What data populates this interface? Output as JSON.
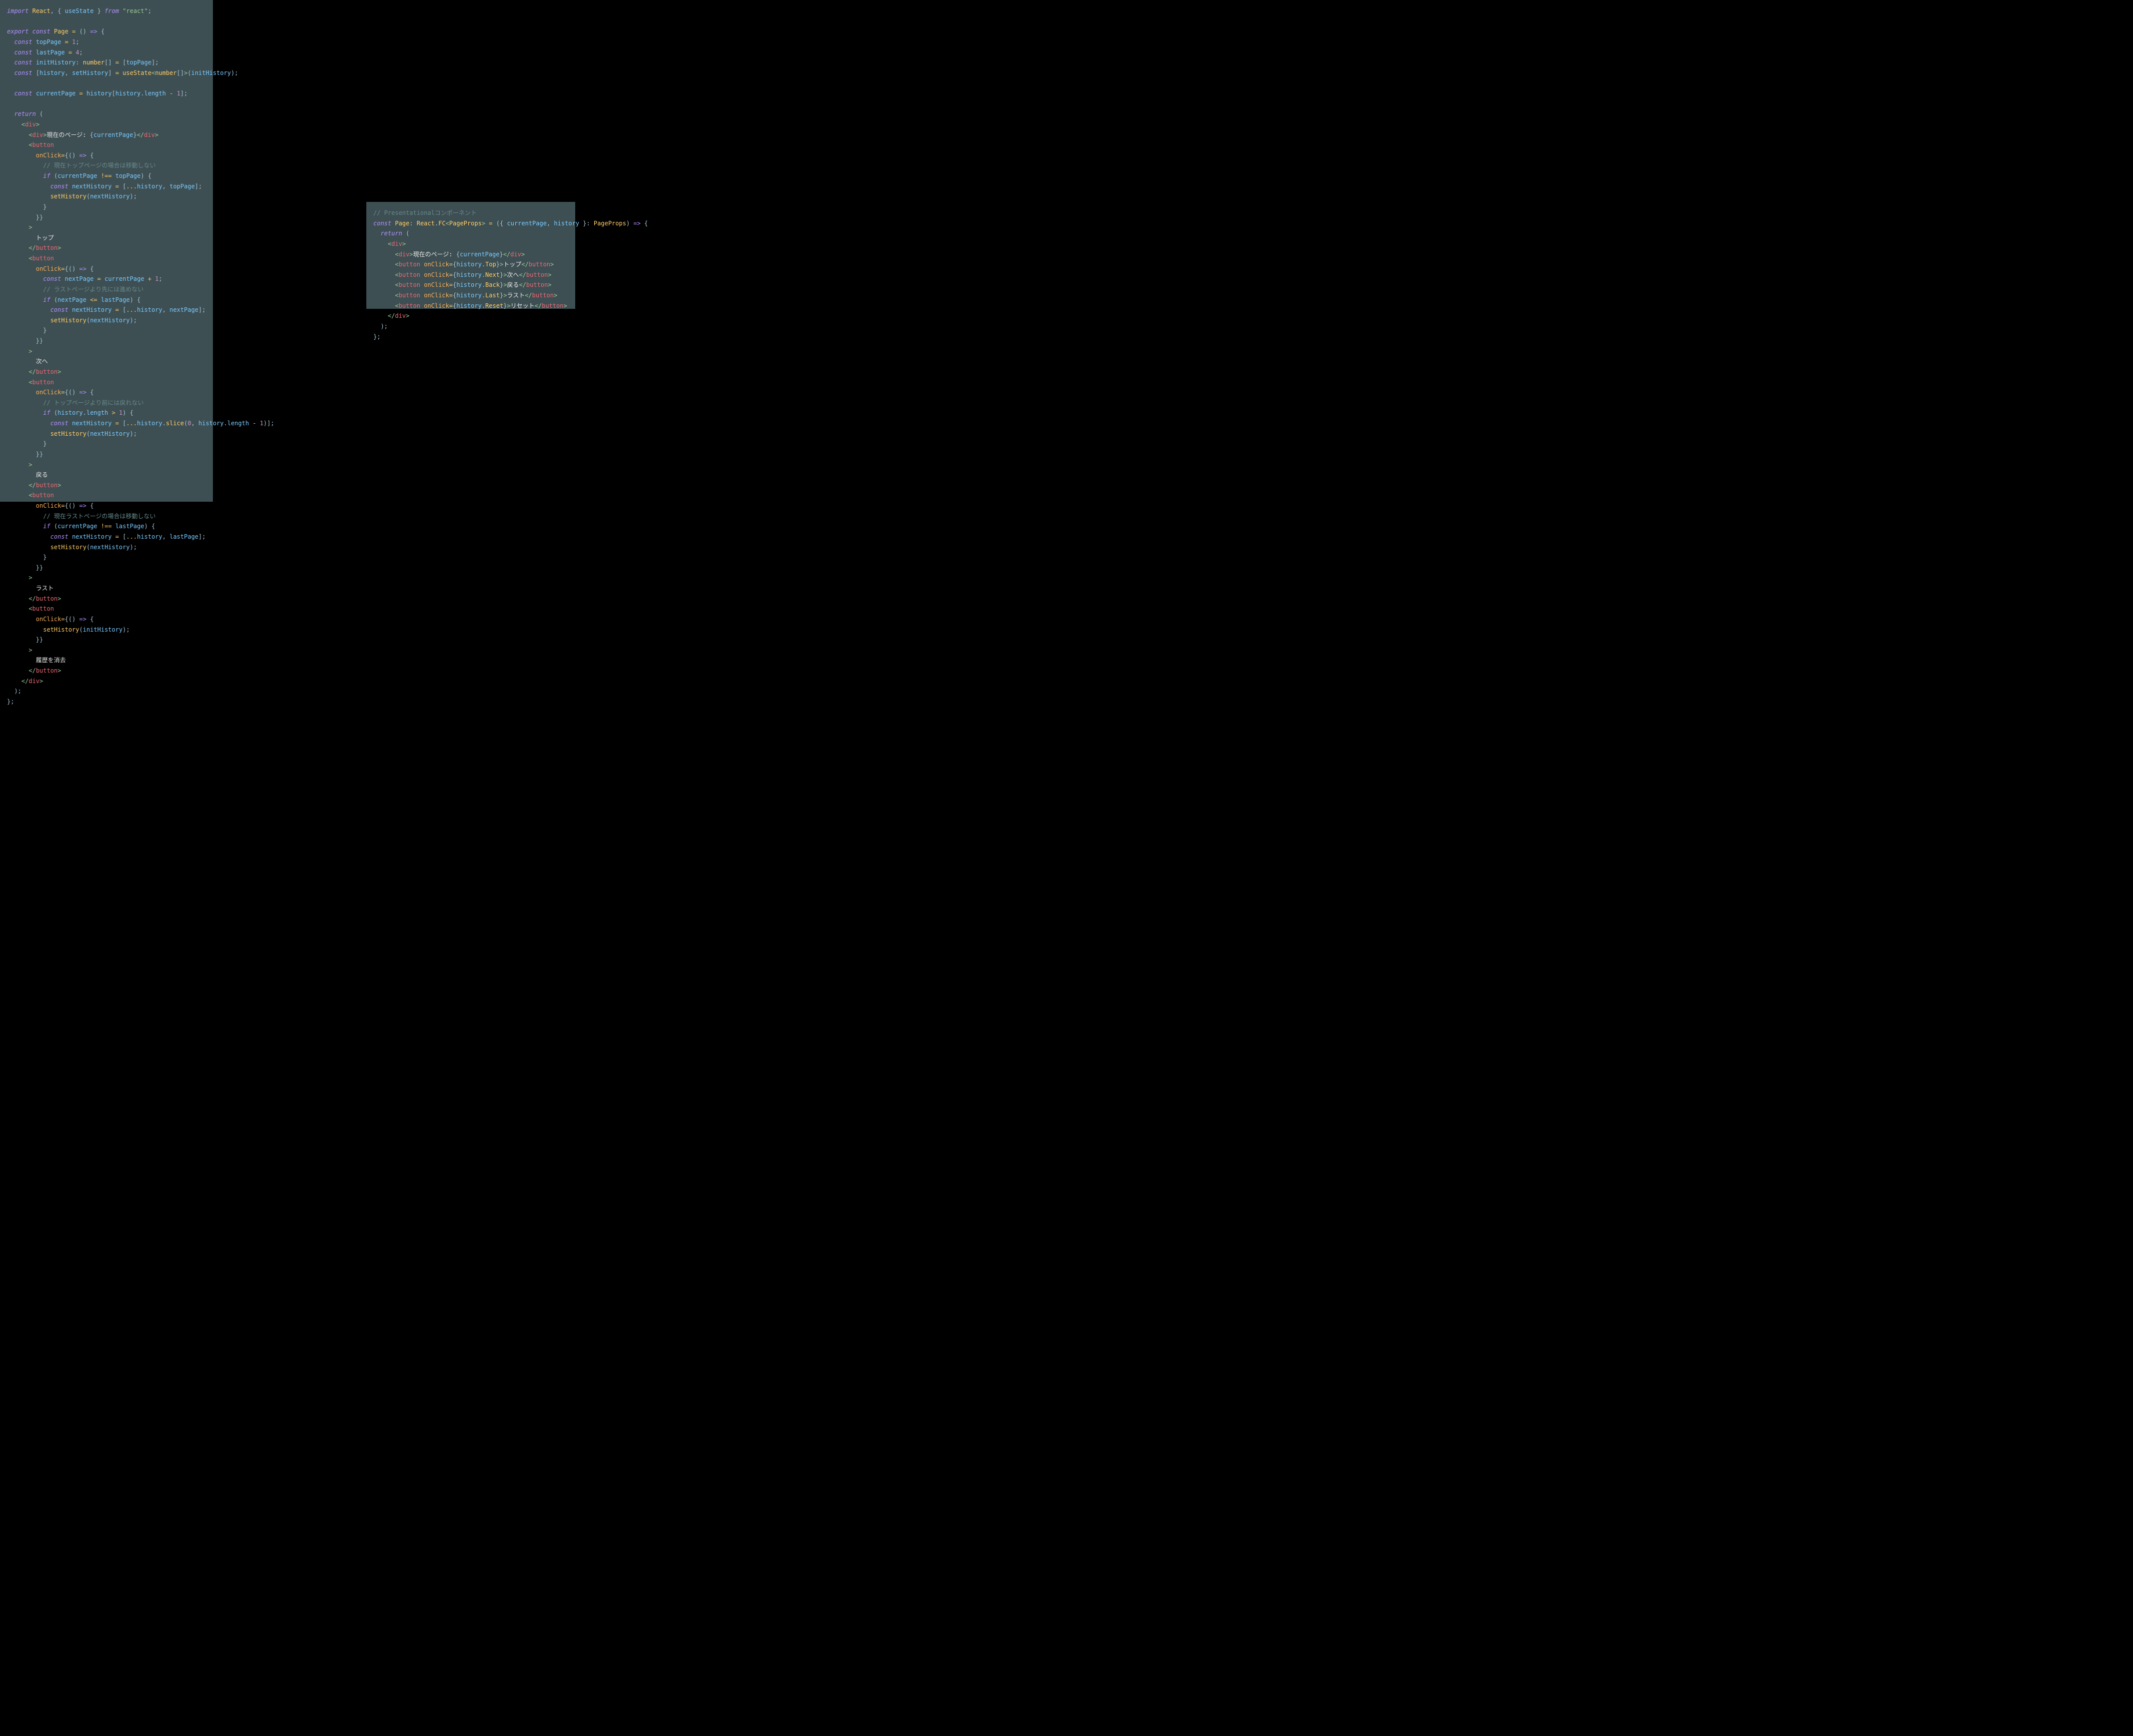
{
  "left": {
    "line01": "import React, { useState } from \"react\";",
    "line03": "export const Page = () => {",
    "line04": "  const topPage = 1;",
    "line05": "  const lastPage = 4;",
    "line06": "  const initHistory: number[] = [topPage];",
    "line07": "  const [history, setHistory] = useState<number[]>(initHistory);",
    "line09": "  const currentPage = history[history.length - 1];",
    "line11": "  return (",
    "line12": "    <div>",
    "line13a": "      <div>",
    "line13b": "現在のページ: ",
    "line13c": "{currentPage}",
    "line13d": "</div>",
    "line14": "      <button",
    "line15": "        onClick={() => {",
    "line16": "          // 現在トップページの場合は移動しない",
    "line17": "          if (currentPage !== topPage) {",
    "line18": "            const nextHistory = [...history, topPage];",
    "line19": "            setHistory(nextHistory);",
    "line20": "          }",
    "line21": "        }}",
    "line22": "      >",
    "line23": "トップ",
    "line24": "      </button>",
    "line25": "      <button",
    "line26": "        onClick={() => {",
    "line27": "          const nextPage = currentPage + 1;",
    "line28": "          // ラストページより先には進めない",
    "line29": "          if (nextPage <= lastPage) {",
    "line30": "            const nextHistory = [...history, nextPage];",
    "line31": "            setHistory(nextHistory);",
    "line32": "          }",
    "line33": "        }}",
    "line34": "      >",
    "line35": "次へ",
    "line36": "      </button>",
    "line37": "      <button",
    "line38": "        onClick={() => {",
    "line39": "          // トップページより前には戻れない",
    "line40": "          if (history.length > 1) {",
    "line41": "            const nextHistory = [...history.slice(0, history.length - 1)];",
    "line42": "            setHistory(nextHistory);",
    "line43": "          }",
    "line44": "        }}",
    "line45": "      >",
    "line46": "戻る",
    "line47": "      </button>",
    "line48": "      <button",
    "line49": "        onClick={() => {",
    "line50": "          // 現在ラストページの場合は移動しない",
    "line51": "          if (currentPage !== lastPage) {",
    "line52": "            const nextHistory = [...history, lastPage];",
    "line53": "            setHistory(nextHistory);",
    "line54": "          }",
    "line55": "        }}",
    "line56": "      >",
    "line57": "ラスト",
    "line58": "      </button>",
    "line59": "      <button",
    "line60": "        onClick={() => {",
    "line61": "          setHistory(initHistory);",
    "line62": "        }}",
    "line63": "      >",
    "line64": "履歴を消去",
    "line65": "      </button>",
    "line66": "    </div>",
    "line67": "  );",
    "line68": "};"
  },
  "right": {
    "line01": "// Presentationalコンポーネント",
    "line02": "const Page: React.FC<PageProps> = ({ currentPage, history }: PageProps) => {",
    "line03": "  return (",
    "line04": "    <div>",
    "line05a": "      <div>",
    "line05b": "現在のページ: ",
    "line05c": "{currentPage}",
    "line05d": "</div>",
    "line06pre": "      <button onClick={history.Top}>",
    "line06btn": "トップ",
    "line06post": "</button>",
    "line07pre": "      <button onClick={history.Next}>",
    "line07btn": "次へ",
    "line07post": "</button>",
    "line08pre": "      <button onClick={history.Back}>",
    "line08btn": "戻る",
    "line08post": "</button>",
    "line09pre": "      <button onClick={history.Last}>",
    "line09btn": "ラスト",
    "line09post": "</button>",
    "line10pre": "      <button onClick={history.Reset}>",
    "line10btn": "リセット",
    "line10post": "</button>",
    "line11": "    </div>",
    "line12": "  );",
    "line13": "};"
  }
}
